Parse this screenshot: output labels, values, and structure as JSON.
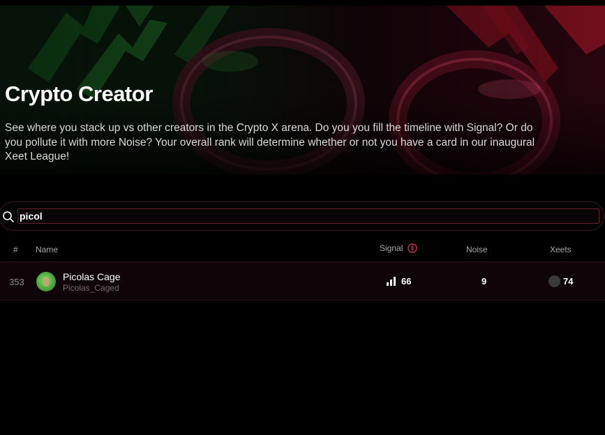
{
  "hero": {
    "title": "Crypto Creator",
    "description": "See where you stack up vs other creators in the Crypto X arena. Do you you fill the timeline with Signal? Or do you pollute it with more Noise? Your overall rank will determine whether or not you have a card in our inaugural Xeet League!"
  },
  "search": {
    "value": "picol",
    "icon": "search-icon"
  },
  "table": {
    "columns": {
      "rank": "#",
      "name": "Name",
      "signal": "Signal",
      "noise": "Noise",
      "xeets": "Xeets"
    },
    "rows": [
      {
        "rank": "353",
        "name": "Picolas Cage",
        "handle": "Picolas_Caged",
        "signal": "66",
        "noise": "9",
        "xeets": "74"
      }
    ]
  },
  "colors": {
    "background": "#000000",
    "accent": "#6b1d2c",
    "row_bg": "#0f0508"
  }
}
